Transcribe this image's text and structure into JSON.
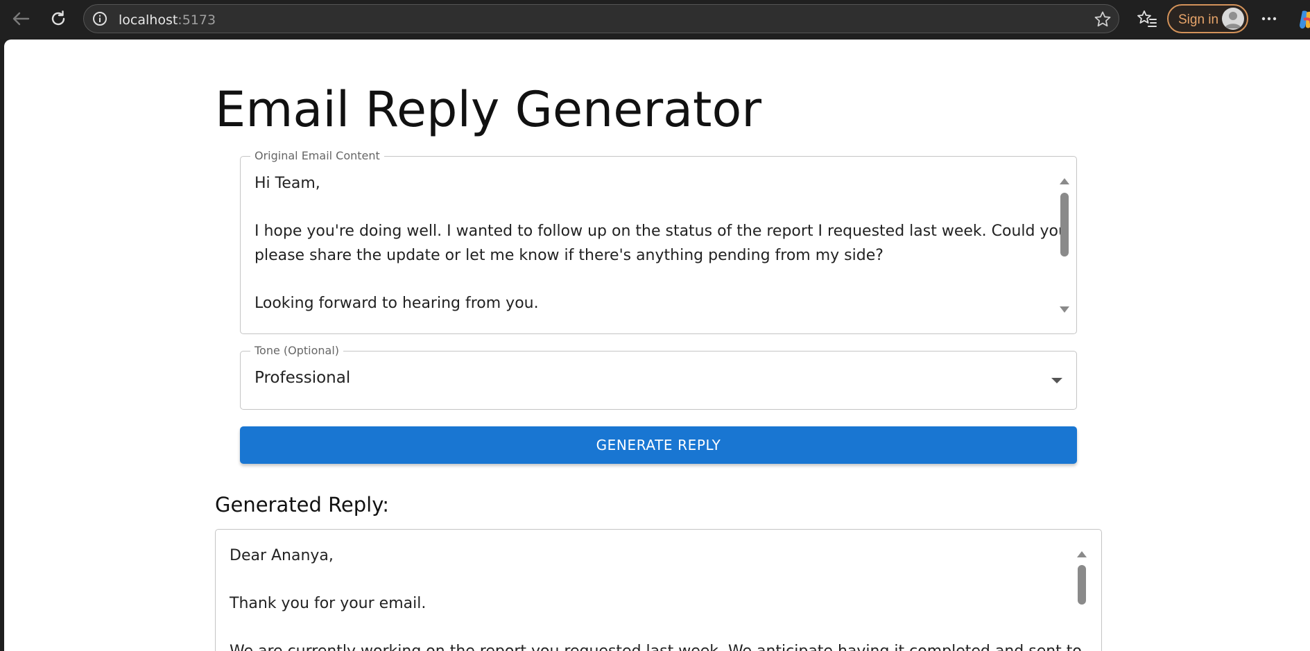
{
  "browser": {
    "url_host": "localhost",
    "url_port": ":5173",
    "sign_in_label": "Sign in",
    "icons": [
      "back-arrow-icon",
      "reload-icon",
      "site-info-icon",
      "star-icon",
      "favorites-icon",
      "avatar-icon",
      "more-icon",
      "copilot-icon"
    ]
  },
  "page": {
    "title": "Email Reply Generator",
    "email_field": {
      "label": "Original Email Content",
      "lines": [
        "Hi Team,",
        "",
        "I hope you're doing well. I wanted to follow up on the status of the report I requested last week. Could you",
        "please share the update or let me know if there's anything pending from my side?",
        "",
        "Looking forward to hearing from you."
      ]
    },
    "tone_field": {
      "label": "Tone (Optional)",
      "value": "Professional"
    },
    "generate_button": "GENERATE REPLY",
    "reply_heading": "Generated Reply:",
    "reply": {
      "lines": [
        "Dear Ananya,",
        "",
        "Thank you for your email.",
        "",
        "We are currently working on the report you requested last week. We anticipate having it completed and sent to"
      ]
    }
  },
  "colors": {
    "primary": "#1976d2",
    "chrome_bg": "#202020",
    "signin_accent": "#e8a56a"
  }
}
